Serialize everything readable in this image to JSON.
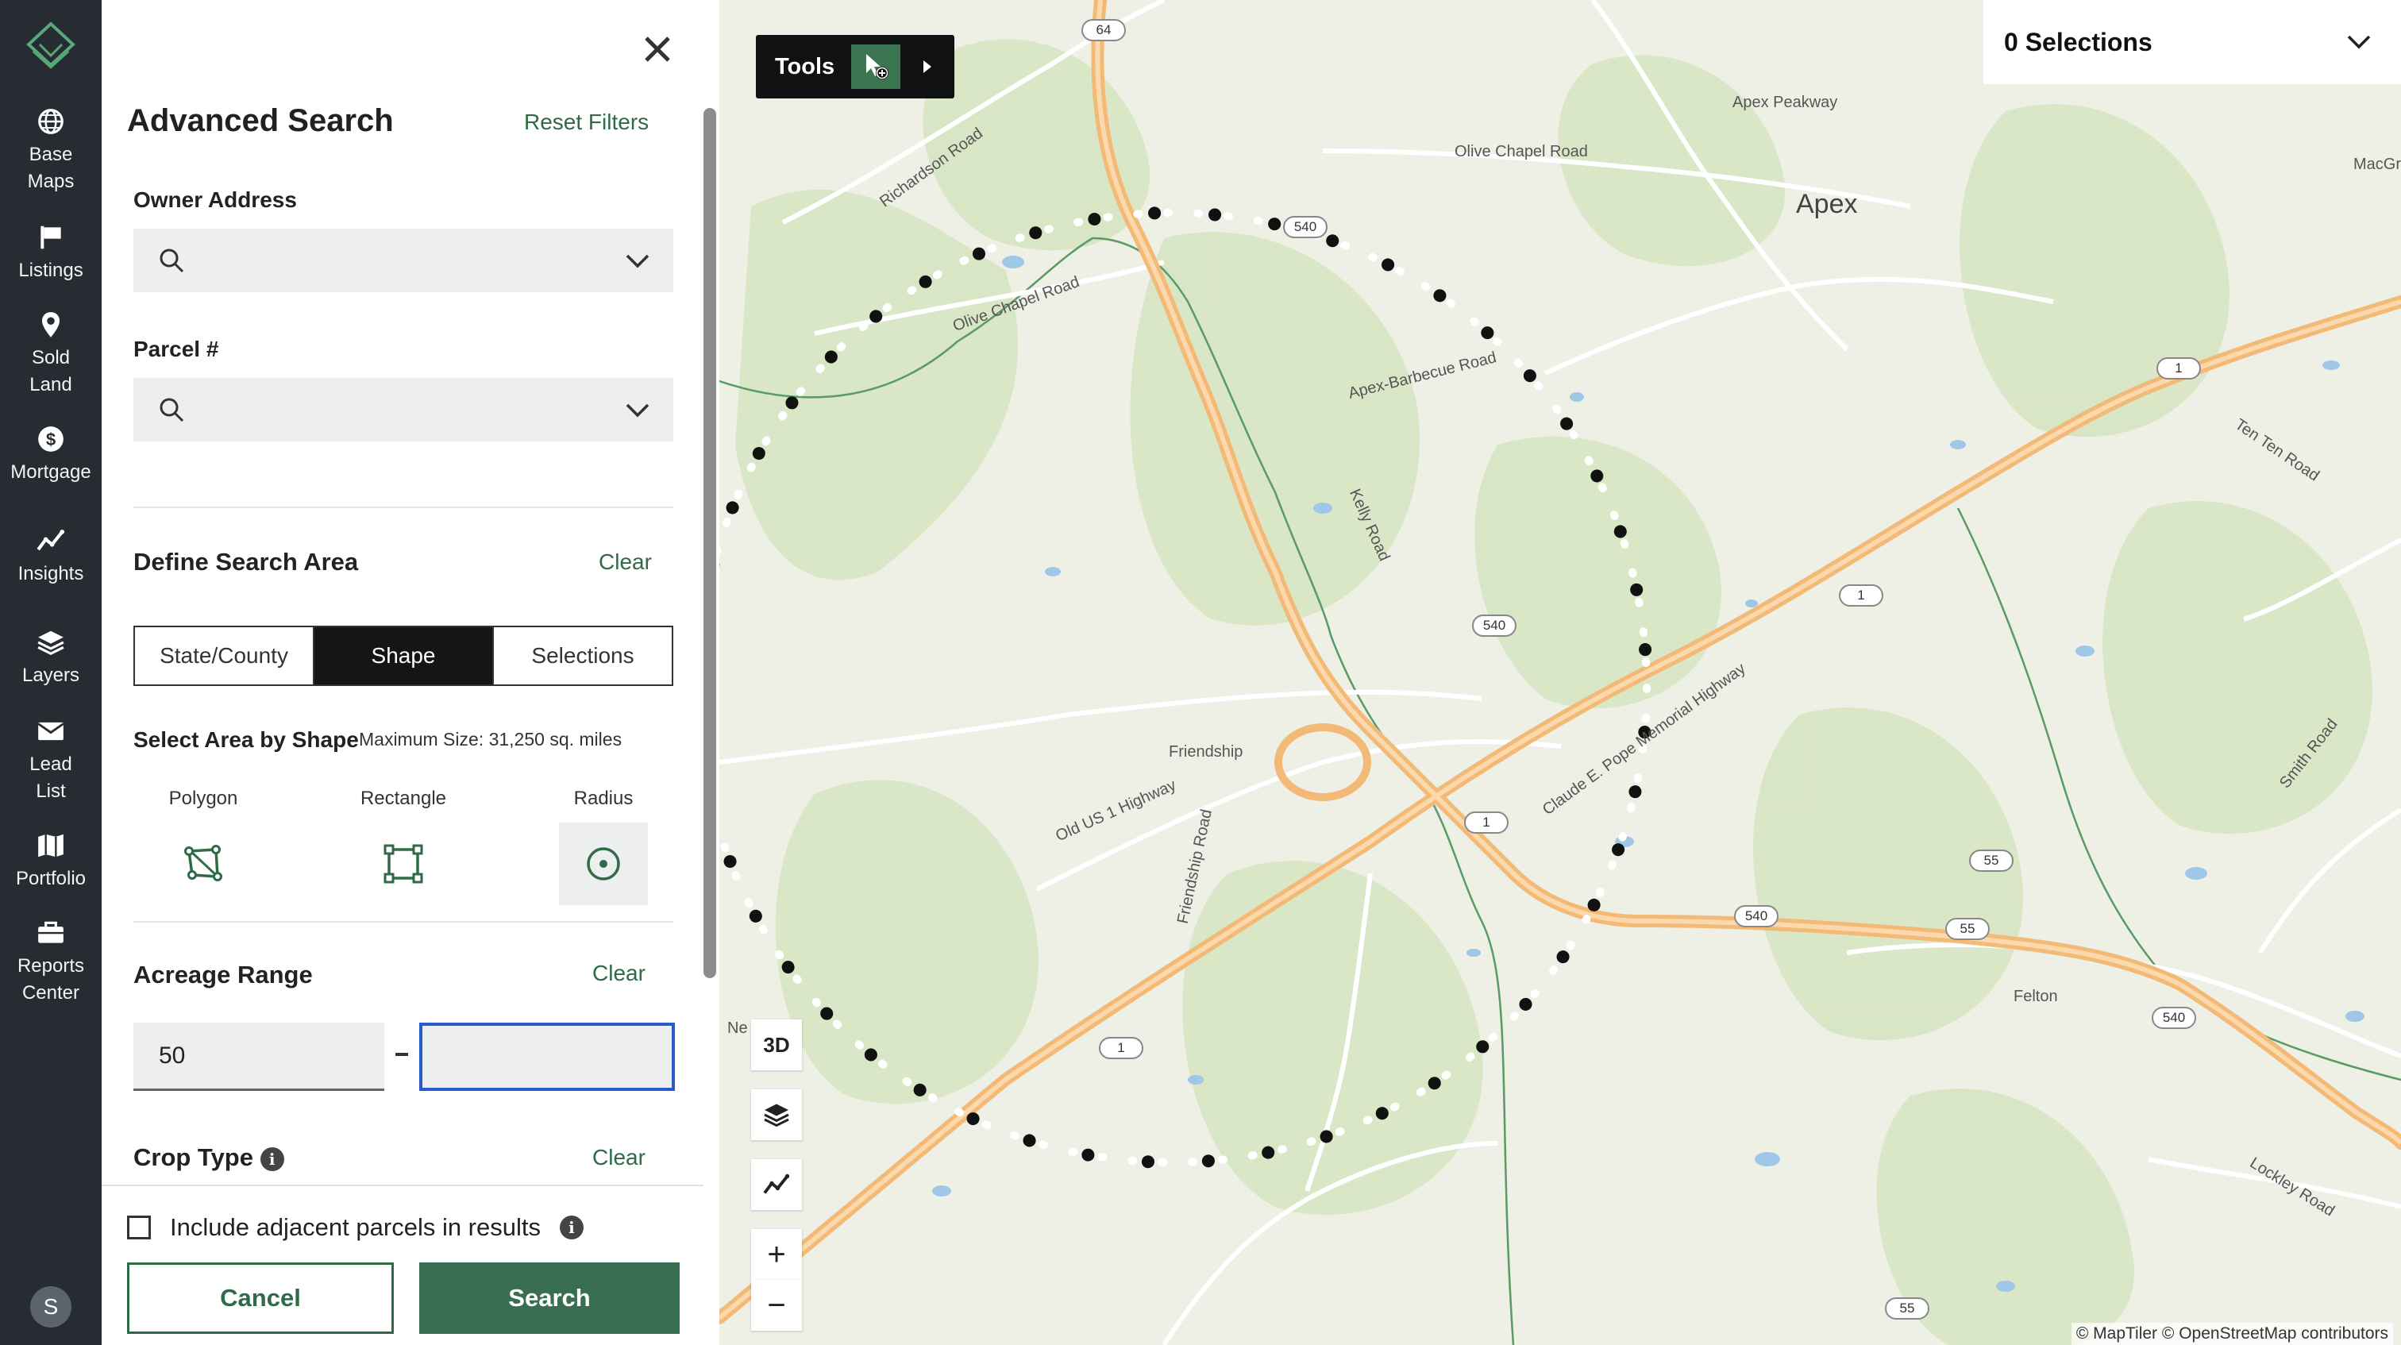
{
  "nav": {
    "items": [
      {
        "label": "Base\nMaps",
        "icon": "globe-icon"
      },
      {
        "label": "Listings",
        "icon": "flag-icon"
      },
      {
        "label": "Sold\nLand",
        "icon": "pin-icon"
      },
      {
        "label": "Mortgage",
        "icon": "dollar-icon"
      },
      {
        "label": "Insights",
        "icon": "trend-icon"
      },
      {
        "label": "Layers",
        "icon": "layers-icon"
      },
      {
        "label": "Lead\nList",
        "icon": "mail-icon"
      },
      {
        "label": "Portfolio",
        "icon": "map-book-icon"
      },
      {
        "label": "Reports\nCenter",
        "icon": "briefcase-icon"
      }
    ],
    "avatar_initial": "S"
  },
  "panel": {
    "title": "Advanced Search",
    "reset_label": "Reset Filters",
    "owner_address": {
      "label": "Owner Address",
      "value": ""
    },
    "parcel": {
      "label": "Parcel #",
      "value": ""
    },
    "search_area": {
      "title": "Define Search Area",
      "clear_label": "Clear",
      "tabs": [
        "State/County",
        "Shape",
        "Selections"
      ],
      "active_tab": "Shape",
      "shape_heading": "Select Area by Shape",
      "max_size": "Maximum Size: 31,250 sq. miles",
      "shapes": [
        "Polygon",
        "Rectangle",
        "Radius"
      ],
      "active_shape": "Radius"
    },
    "acreage": {
      "title": "Acreage Range",
      "clear_label": "Clear",
      "min": "50",
      "max": ""
    },
    "crop_type": {
      "title": "Crop Type",
      "clear_label": "Clear"
    },
    "include_adjacent": {
      "label": "Include adjacent parcels in results",
      "checked": false
    },
    "cancel_label": "Cancel",
    "search_label": "Search"
  },
  "map": {
    "tools_label": "Tools",
    "selections_label": "0 Selections",
    "control_3d": "3D",
    "zoom_in": "+",
    "zoom_out": "−",
    "attribution": "© MapTiler © OpenStreetMap contributors",
    "city": "Apex",
    "labels": {
      "apex_peakway": "Apex Peakway",
      "olive_chapel_road_top": "Olive Chapel Road",
      "richardson_road": "Richardson Road",
      "olive_chapel_road_left": "Olive Chapel Road",
      "apex_barbecue_road": "Apex-Barbecue Road",
      "kelly_road": "Kelly Road",
      "friendship": "Friendship",
      "old_us1": "Old US 1 Highway",
      "friendship_road": "Friendship Road",
      "pope_highway": "Claude E. Pope Memorial Highway",
      "ten_ten_road": "Ten Ten Road",
      "smith_road": "Smith Road",
      "lockley_road": "Lockley Road",
      "macgreg": "MacGreg",
      "felton": "Felton",
      "ne": "Ne"
    },
    "shields": [
      "64",
      "540",
      "1",
      "540",
      "1",
      "1",
      "55",
      "540",
      "55",
      "540",
      "55",
      "1"
    ]
  }
}
